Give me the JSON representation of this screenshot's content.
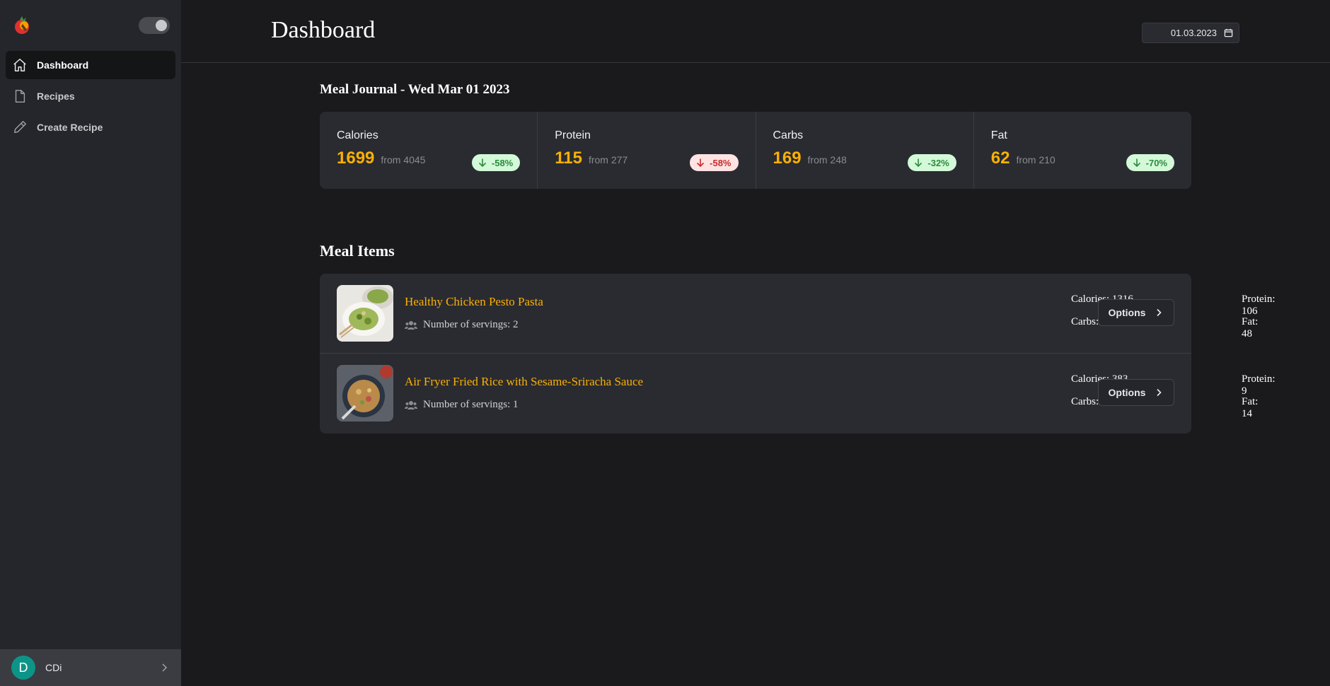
{
  "colors": {
    "accent": "#fab005",
    "positive_badge": "#d3f9d8",
    "negative_badge": "#ffe3e3",
    "avatar": "#0d9488"
  },
  "sidebar": {
    "logo_icon": "tomato-logo-icon",
    "items": [
      {
        "label": "Dashboard",
        "icon": "home-icon",
        "active": true
      },
      {
        "label": "Recipes",
        "icon": "file-icon",
        "active": false
      },
      {
        "label": "Create Recipe",
        "icon": "pencil-icon",
        "active": false
      }
    ],
    "user": {
      "initial": "D",
      "name": "CDi"
    }
  },
  "header": {
    "title": "Dashboard",
    "date": "01.03.2023"
  },
  "journal": {
    "title": "Meal Journal - Wed Mar 01 2023",
    "stats": [
      {
        "label": "Calories",
        "value": "1699",
        "from": "from 4045",
        "change": "-58%",
        "trend": "green"
      },
      {
        "label": "Protein",
        "value": "115",
        "from": "from 277",
        "change": "-58%",
        "trend": "red"
      },
      {
        "label": "Carbs",
        "value": "169",
        "from": "from 248",
        "change": "-32%",
        "trend": "green"
      },
      {
        "label": "Fat",
        "value": "62",
        "from": "from 210",
        "change": "-70%",
        "trend": "green"
      }
    ]
  },
  "meal_items": {
    "title": "Meal Items",
    "items": [
      {
        "name": "Healthy Chicken Pesto Pasta",
        "servings": "Number of servings: 2",
        "calories": "Calories: 1316",
        "carbs": "Carbs: 116",
        "protein": "Protein: 106",
        "fat": "Fat: 48",
        "options": "Options"
      },
      {
        "name": "Air Fryer Fried Rice with Sesame-Sriracha Sauce",
        "servings": "Number of servings: 1",
        "calories": "Calories: 383",
        "carbs": "Carbs: 53",
        "protein": "Protein: 9",
        "fat": "Fat: 14",
        "options": "Options"
      }
    ]
  }
}
